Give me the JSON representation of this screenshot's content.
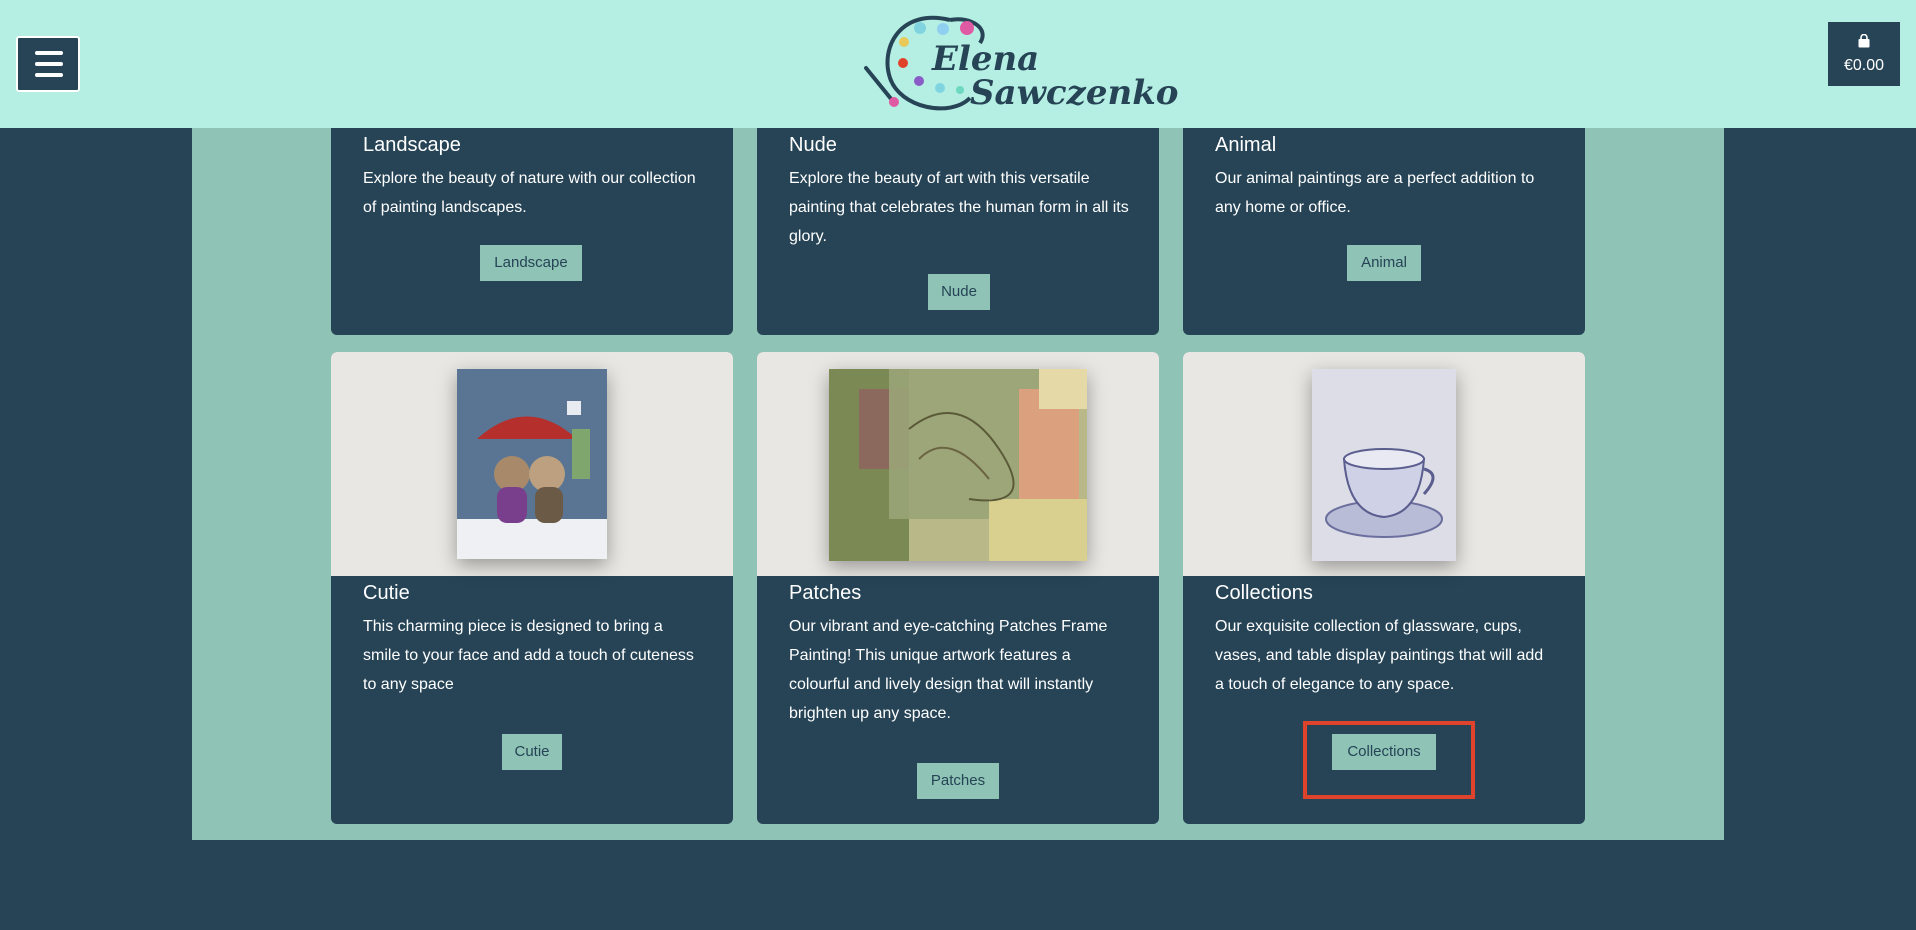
{
  "header": {
    "logo_line1": "Elena",
    "logo_line2": "Sawczenko",
    "cart_total": "€0.00"
  },
  "categories": [
    {
      "title": "Landscape",
      "description": "Explore the beauty of nature with our collection of painting landscapes.",
      "button": "Landscape"
    },
    {
      "title": "Nude",
      "description": "Explore the beauty of art with this versatile painting that celebrates the human form in all its glory.",
      "button": "Nude"
    },
    {
      "title": "Animal",
      "description": "Our animal paintings are a perfect addition to any home or office.",
      "button": "Animal"
    },
    {
      "title": "Cutie",
      "description": "This charming piece is designed to bring a smile to your face and add a touch of cuteness to any space",
      "button": "Cutie"
    },
    {
      "title": "Patches",
      "description": "Our vibrant and eye-catching Patches Frame Painting! This unique artwork features a colourful and lively design that will instantly brighten up any space.",
      "button": "Patches"
    },
    {
      "title": "Collections",
      "description": "Our exquisite collection of glassware, cups, vases, and table display paintings that will add a touch of elegance to any space.",
      "button": "Collections"
    }
  ],
  "colors": {
    "header_bg": "#b5efe3",
    "page_bg": "#264456",
    "content_bg": "#8ec3b5",
    "button_bg": "#8ec3b5",
    "highlight": "#e0432b"
  }
}
